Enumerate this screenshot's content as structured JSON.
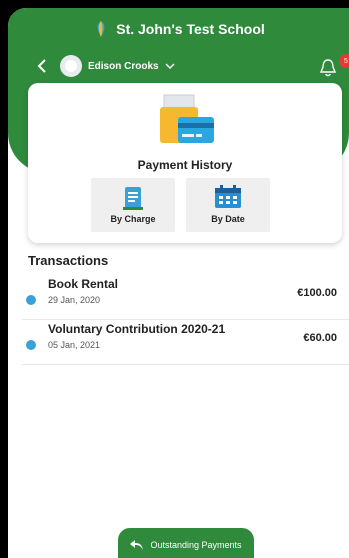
{
  "header": {
    "school_name": "St. John's Test School",
    "user_name": "Edison Crooks",
    "notification_count": "5",
    "colors": {
      "brand_green": "#2f8a3c",
      "badge_red": "#e53935"
    }
  },
  "card": {
    "title": "Payment History",
    "filters": [
      {
        "label": "By Charge",
        "icon": "document-icon"
      },
      {
        "label": "By Date",
        "icon": "calendar-icon"
      }
    ]
  },
  "transactions": {
    "title": "Transactions",
    "items": [
      {
        "name": "Book Rental",
        "date": "29 Jan, 2020",
        "amount": "€100.00"
      },
      {
        "name": "Voluntary Contribution 2020-21",
        "date": "05 Jan, 2021",
        "amount": "€60.00"
      }
    ],
    "dot_color": "#3aa1d8"
  },
  "footer": {
    "outstanding_label": "Outstanding Payments"
  }
}
